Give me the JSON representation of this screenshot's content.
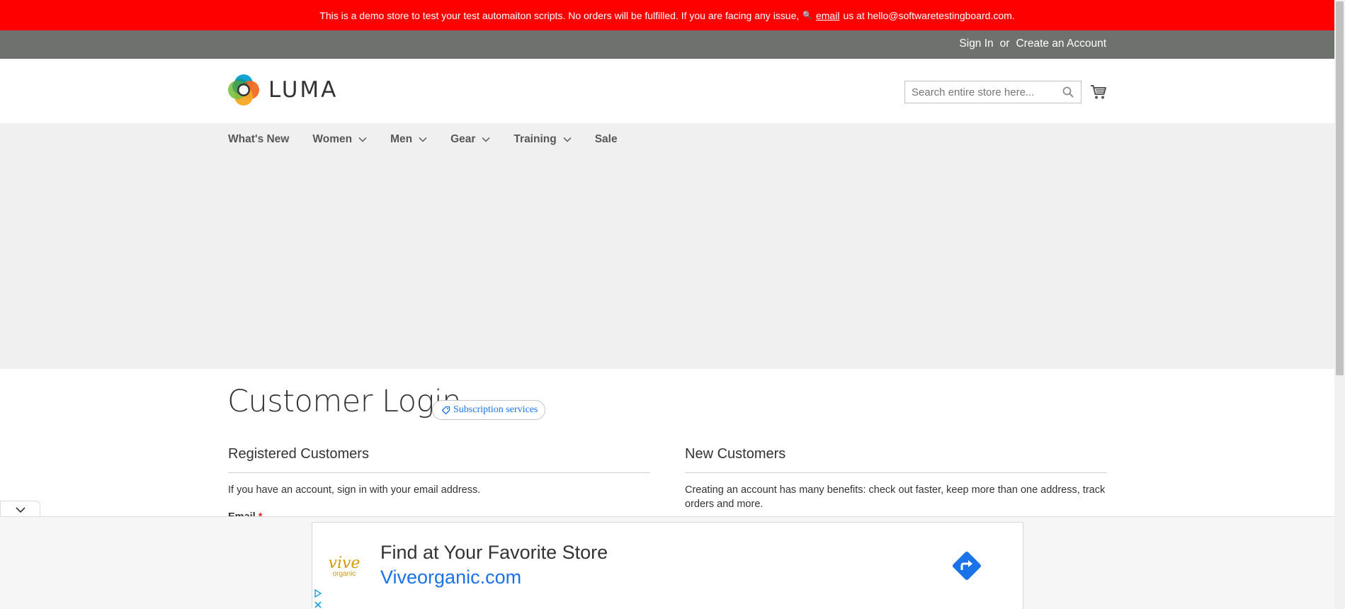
{
  "demo_notice": {
    "text_before": "This is a demo store to test your test automaiton scripts. No orders will be fulfilled. If you are facing any issue,",
    "link": "email",
    "text_after": "us at hello@softwaretestingboard.com."
  },
  "top_links": {
    "sign_in": "Sign In",
    "or": "or",
    "create_account": "Create an Account"
  },
  "logo": {
    "text": "LUMA"
  },
  "search": {
    "placeholder": "Search entire store here..."
  },
  "nav": {
    "items": [
      {
        "label": "What's New",
        "has_dropdown": false
      },
      {
        "label": "Women",
        "has_dropdown": true
      },
      {
        "label": "Men",
        "has_dropdown": true
      },
      {
        "label": "Gear",
        "has_dropdown": true
      },
      {
        "label": "Training",
        "has_dropdown": true
      },
      {
        "label": "Sale",
        "has_dropdown": false
      }
    ]
  },
  "page": {
    "title": "Customer Login",
    "subscription_button": "Subscription services"
  },
  "registered": {
    "title": "Registered Customers",
    "text": "If you have an account, sign in with your email address.",
    "email_label": "Email",
    "required_mark": "*"
  },
  "new_customers": {
    "title": "New Customers",
    "text": "Creating an account has many benefits: check out faster, keep more than one address, track orders and more."
  },
  "ad": {
    "logo_brand": "vive",
    "logo_sub": "organic",
    "headline": "Find at Your Favorite Store",
    "url": "Viveorganic.com"
  },
  "colors": {
    "demo_bar": "#ff0000",
    "top_bar": "#6e716e",
    "nav_bg": "#f0f0f0",
    "link_blue": "#1a73e8",
    "required_red": "#e02b27"
  }
}
